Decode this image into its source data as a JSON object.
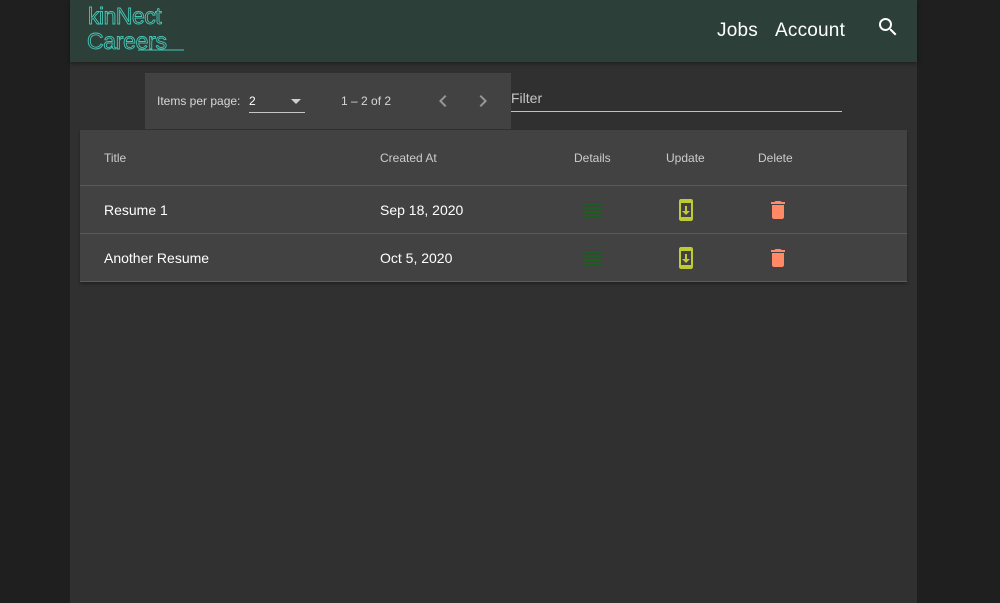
{
  "header": {
    "logo_line1": "kinNect",
    "logo_line2": "Careers",
    "nav": [
      {
        "label": "Jobs"
      },
      {
        "label": "Account"
      }
    ],
    "search_icon": "search-icon"
  },
  "paginator": {
    "items_per_page_label": "Items per page:",
    "items_per_page_value": "2",
    "range_label": "1 – 2 of 2",
    "prev_icon": "chevron-left-icon",
    "next_icon": "chevron-right-icon"
  },
  "filter": {
    "placeholder": "Filter",
    "value": ""
  },
  "table": {
    "columns": [
      "Title",
      "Created At",
      "Details",
      "Update",
      "Delete"
    ],
    "rows": [
      {
        "title": "Resume 1",
        "created_at": "Sep 18, 2020"
      },
      {
        "title": "Another Resume",
        "created_at": "Oct 5, 2020"
      }
    ],
    "icons": {
      "details": "list-icon",
      "update": "system-update-icon",
      "delete": "trash-icon"
    }
  },
  "colors": {
    "logo": "#47c7b7",
    "toolbar": "#2c3f38",
    "details_icon": "#1b5e20",
    "update_icon": "#c0ca33",
    "delete_icon": "#ff8a65",
    "background": "#303030",
    "surface": "#424242"
  }
}
